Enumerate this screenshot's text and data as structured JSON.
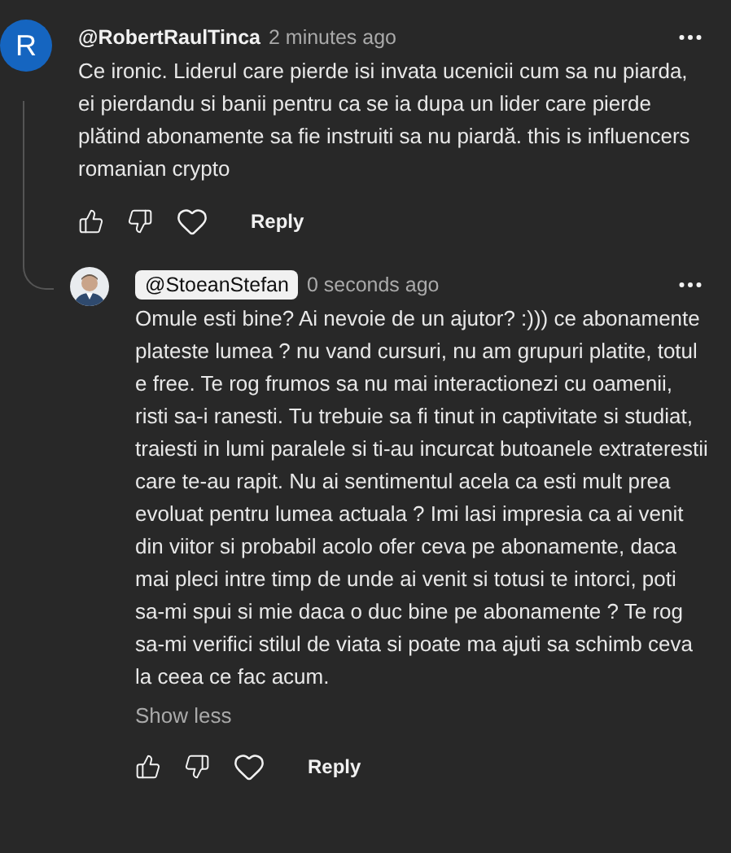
{
  "comments": [
    {
      "author": "@RobertRaulTinca",
      "time": "2 minutes ago",
      "avatar": {
        "kind": "letter",
        "letter": "R",
        "color": "#1565c0"
      },
      "author_highlighted": false,
      "text": "Ce ironic. Liderul care pierde isi invata ucenicii cum sa nu piarda, ei pierdandu si banii pentru ca se ia dupa un lider care pierde plătind abonamente sa fie instruiti sa nu piardă. this is influencers romanian crypto",
      "reply_label": "Reply",
      "children": [
        {
          "author": "@StoeanStefan",
          "time": "0 seconds ago",
          "author_highlighted": true,
          "text": "Omule esti bine? Ai nevoie de un ajutor? :))) ce abonamente plateste lumea ? nu vand cursuri, nu am grupuri platite, totul e free. Te rog frumos sa nu mai interactionezi cu oamenii, risti sa-i ranesti. Tu trebuie sa fi tinut in captivitate si studiat, traiesti in lumi paralele si ti-au incurcat butoanele extraterestii care te-au rapit. Nu ai sentimentul acela ca esti mult prea evoluat pentru lumea actuala ? Imi lasi impresia ca ai venit din viitor si probabil acolo ofer ceva pe abonamente, daca mai pleci intre timp de unde ai venit si totusi te intorci, poti sa-mi spui si mie daca o duc bine pe abonamente ? Te rog sa-mi verifici stilul de viata si poate ma ajuti sa schimb ceva la ceea ce fac acum.",
          "show_less": "Show less",
          "reply_label": "Reply"
        }
      ]
    }
  ]
}
